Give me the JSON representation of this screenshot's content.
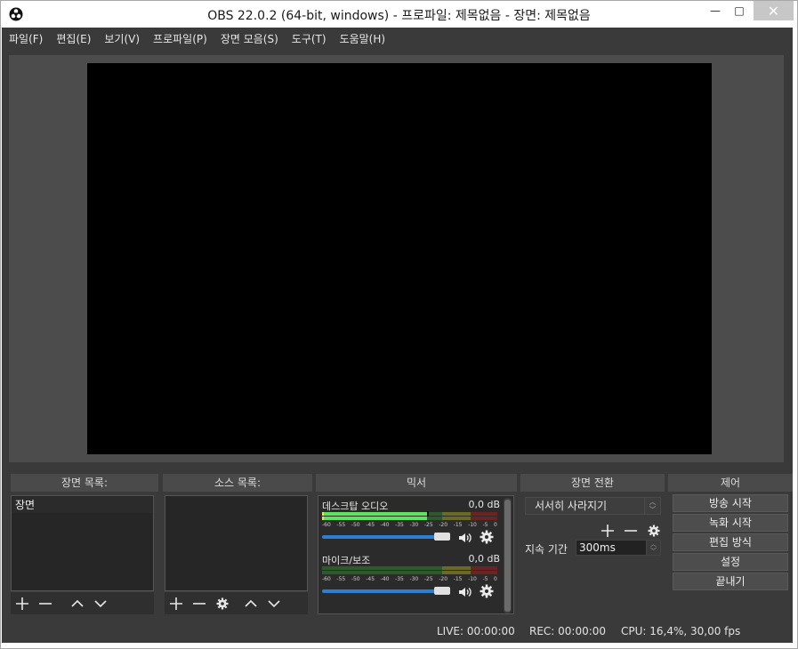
{
  "window": {
    "title": "OBS 22.0.2 (64-bit, windows) - 프로파일: 제목없음 - 장면: 제목없음",
    "minimize_glyph": "—",
    "maximize_glyph": "□",
    "close_glyph": "✕"
  },
  "menu": [
    {
      "label": "파일(F)"
    },
    {
      "label": "편집(E)"
    },
    {
      "label": "보기(V)"
    },
    {
      "label": "프로파일(P)"
    },
    {
      "label": "장면 모음(S)"
    },
    {
      "label": "도구(T)"
    },
    {
      "label": "도움말(H)"
    }
  ],
  "docks": {
    "scenes": {
      "title": "장면 목록:",
      "items": [
        "장면"
      ]
    },
    "sources": {
      "title": "소스 목록:",
      "items": []
    },
    "mixer": {
      "title": "믹서"
    },
    "transitions": {
      "title": "장면 전환"
    },
    "controls": {
      "title": "제어"
    }
  },
  "mixer": {
    "channels": [
      {
        "name": "데스크탑 오디오",
        "db": "0,0 dB",
        "level": 0.6,
        "volume": 1.0
      },
      {
        "name": "마이크/보조",
        "db": "0,0 dB",
        "level": 0.0,
        "volume": 1.0
      }
    ],
    "ticks": [
      "-60",
      "-55",
      "-50",
      "-45",
      "-40",
      "-35",
      "-30",
      "-25",
      "-20",
      "-15",
      "-10",
      "-5",
      "0"
    ]
  },
  "transitions": {
    "selected": "서서히 사라지기",
    "duration_label": "지속 기간",
    "duration_value": "300ms"
  },
  "controls": {
    "buttons": [
      "방송 시작",
      "녹화 시작",
      "편집 방식",
      "설정",
      "끝내기"
    ]
  },
  "status": {
    "live": "LIVE: 00:00:00",
    "rec": "REC: 00:00:00",
    "cpu": "CPU: 16,4%, 30,00 fps"
  },
  "colors": {
    "panel_bg": "#3a3a3a",
    "preview_bg": "#4c4c4c",
    "canvas": "#000000",
    "meter_green": "#5fe35f",
    "volume_blue": "#2d7fd1"
  }
}
